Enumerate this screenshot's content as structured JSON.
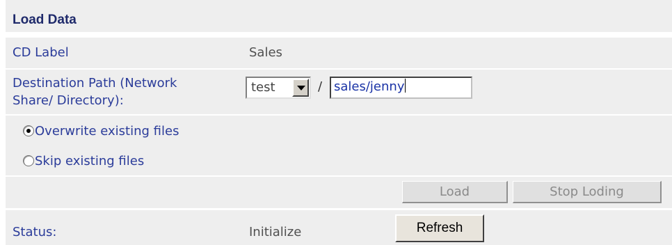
{
  "section": {
    "title": "Load Data"
  },
  "cd_label": {
    "label": "CD Label",
    "value": "Sales"
  },
  "destination": {
    "label_line1": "Destination Path (Network",
    "label_line2": "Share/ Directory):",
    "share_selected": "test",
    "separator": "/",
    "directory_value": "sales/jenny"
  },
  "options": {
    "overwrite": {
      "label": "Overwrite existing files",
      "checked": true
    },
    "skip": {
      "label": "Skip existing files",
      "checked": false
    }
  },
  "buttons": {
    "load": "Load",
    "stop": "Stop Loding",
    "refresh": "Refresh"
  },
  "status": {
    "label": "Status:",
    "value": "Initialize"
  }
}
